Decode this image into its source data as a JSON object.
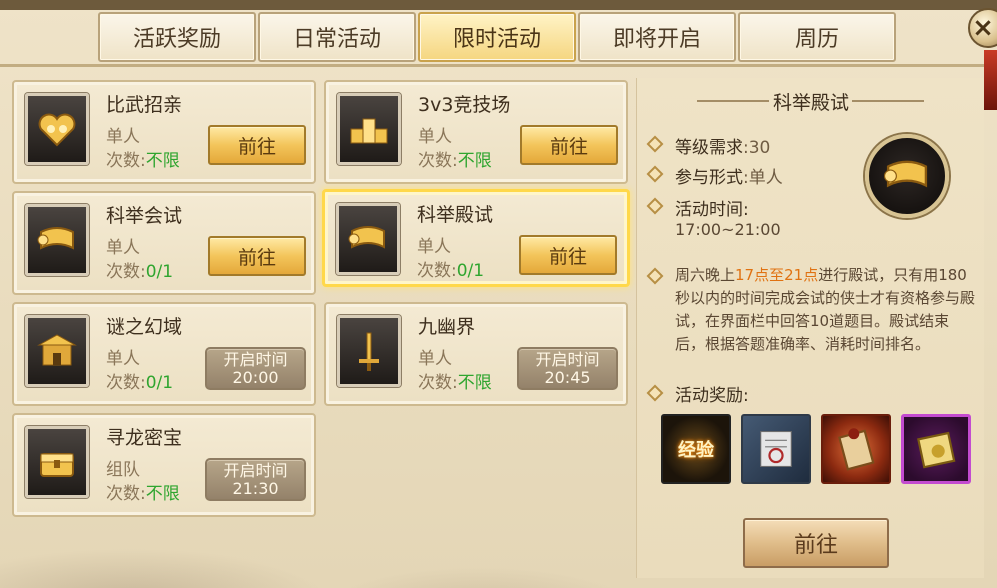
{
  "tabs": [
    {
      "label": "活跃奖励"
    },
    {
      "label": "日常活动"
    },
    {
      "label": "限时活动"
    },
    {
      "label": "即将开启"
    },
    {
      "label": "周历"
    }
  ],
  "close_label": "×",
  "go_label": "前往",
  "count_prefix": "次数:",
  "time_label": "开启时间",
  "cards": [
    {
      "title": "比武招亲",
      "type": "单人",
      "count": "不限",
      "icon": "hearts-icon"
    },
    {
      "title": "3v3竞技场",
      "type": "单人",
      "count": "不限",
      "icon": "podium-icon"
    },
    {
      "title": "科举会试",
      "type": "单人",
      "count": "0/1",
      "icon": "scroll-icon"
    },
    {
      "title": "科举殿试",
      "type": "单人",
      "count": "0/1",
      "icon": "scroll-icon"
    },
    {
      "title": "谜之幻域",
      "type": "单人",
      "count": "0/1",
      "icon": "pavilion-icon",
      "open_time": "20:00"
    },
    {
      "title": "九幽界",
      "type": "单人",
      "count": "不限",
      "icon": "sword-icon",
      "open_time": "20:45"
    },
    {
      "title": "寻龙密宝",
      "type": "组队",
      "count": "不限",
      "icon": "chest-icon",
      "open_time": "21:30"
    }
  ],
  "detail": {
    "title": "科举殿试",
    "level_label": "等级需求",
    "level_value": ":30",
    "form_label": "参与形式",
    "form_value": ":单人",
    "time_label": "活动时间:",
    "time_value": "17:00~21:00",
    "desc_1": "周六晚上",
    "desc_highlight": "17点至21点",
    "desc_2": "进行殿试，只有用180秒以内的时间完成会试的侠士才有资格参与殿试，在界面栏中回答10道题目。殿试结束后，根据答题准确率、消耗时间排名。",
    "rewards_label": "活动奖励:",
    "rewards": [
      {
        "label": "经验",
        "icon": "exp-icon"
      },
      {
        "label": "",
        "icon": "silver-note-icon"
      },
      {
        "label": "",
        "icon": "red-scroll-icon"
      },
      {
        "label": "",
        "icon": "gold-scroll-icon"
      }
    ],
    "go_label": "前往"
  },
  "colors": {
    "accent": "#f5d680",
    "highlight": "#e07212",
    "unlimited": "#2fa52f",
    "selected_border": "#ffd84a"
  }
}
